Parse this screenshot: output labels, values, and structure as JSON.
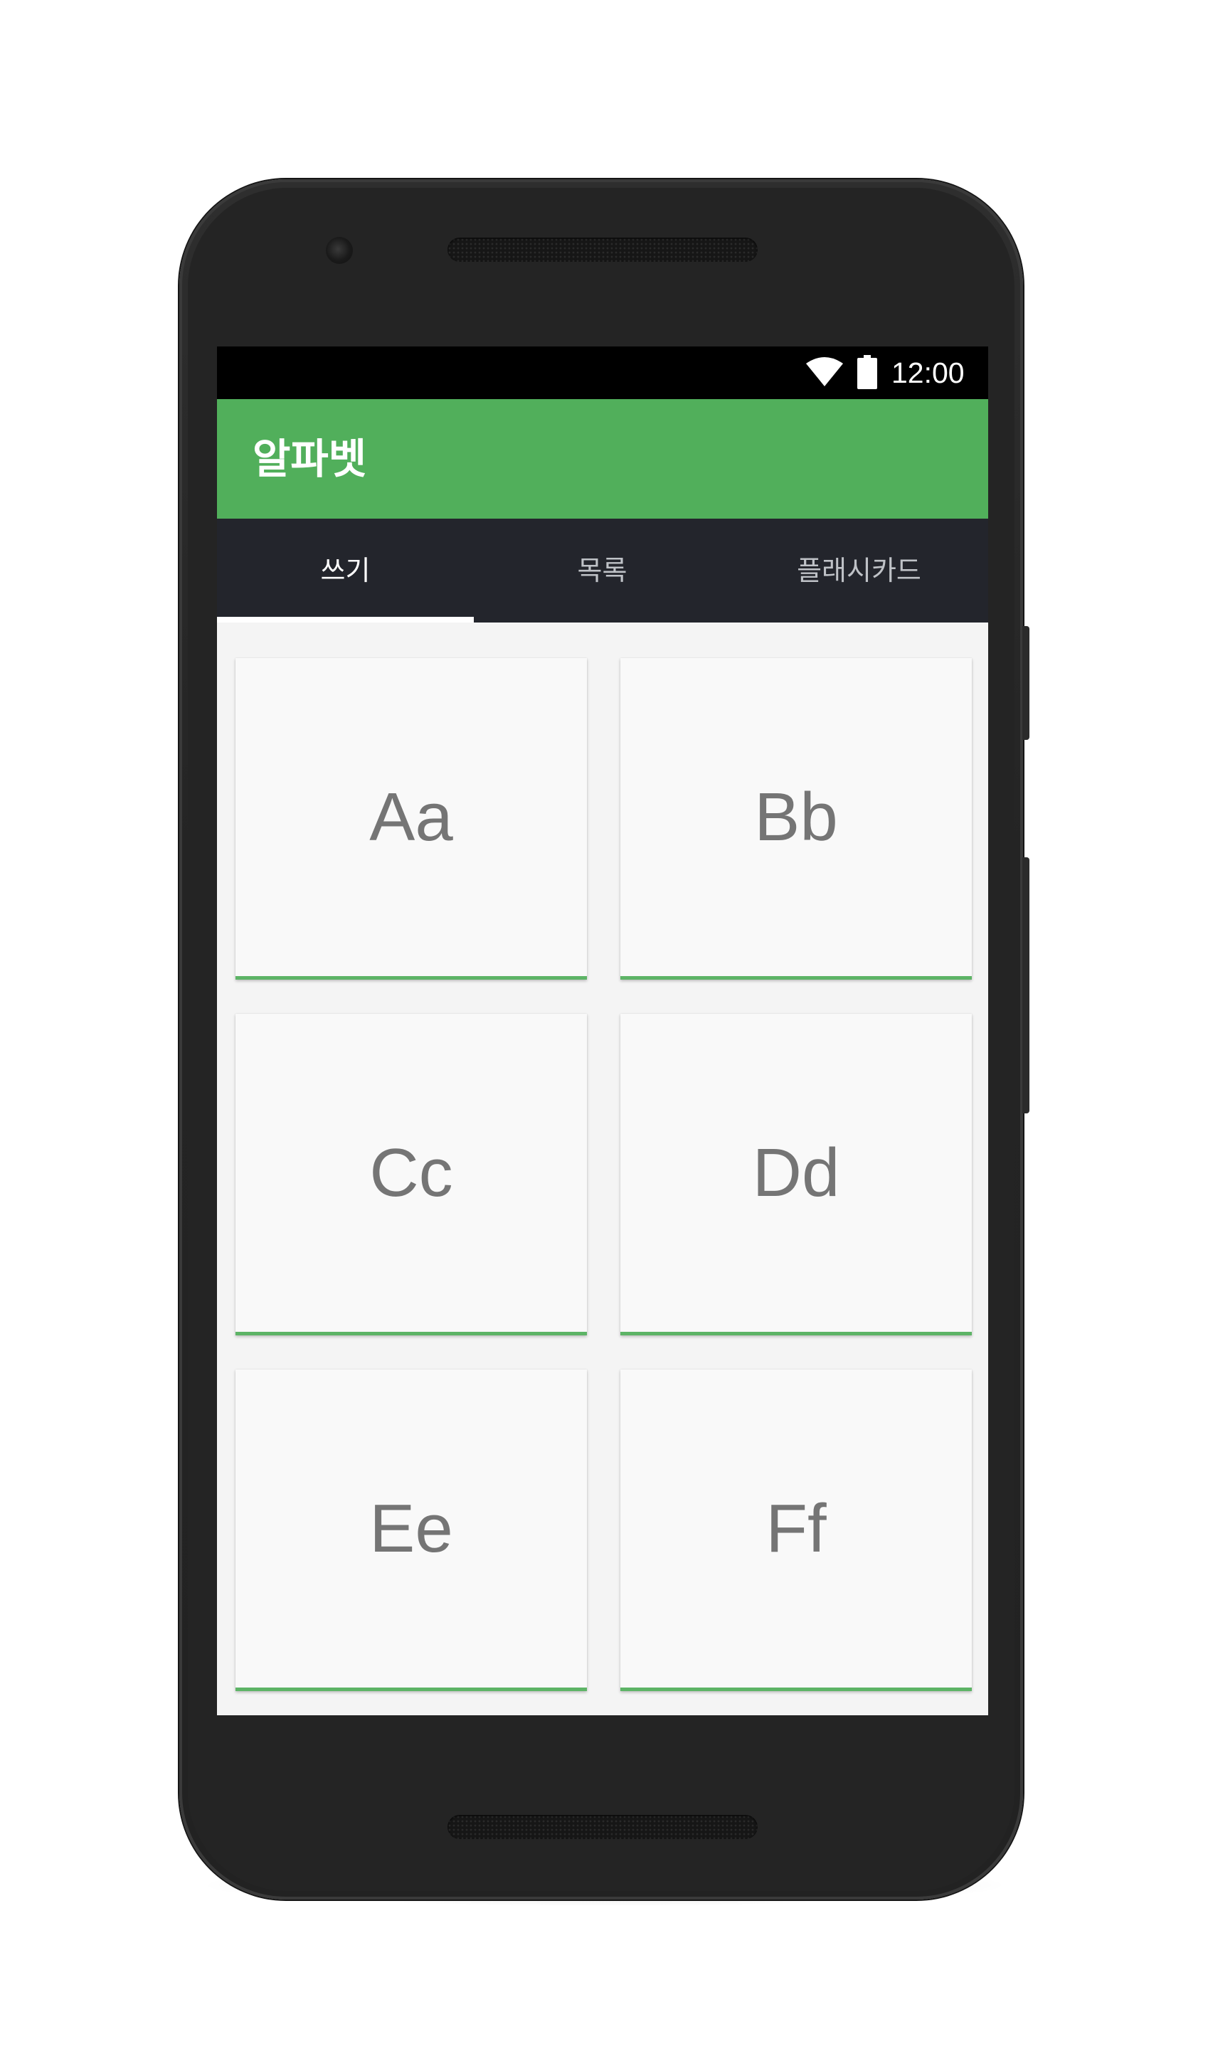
{
  "status_bar": {
    "time": "12:00",
    "wifi_icon": "wifi-icon",
    "battery_icon": "battery-icon"
  },
  "app_bar": {
    "title": "알파벳"
  },
  "tabs": [
    {
      "label": "쓰기",
      "active": true
    },
    {
      "label": "목록",
      "active": false
    },
    {
      "label": "플래시카드",
      "active": false
    }
  ],
  "cards": [
    {
      "label": "Aa"
    },
    {
      "label": "Bb"
    },
    {
      "label": "Cc"
    },
    {
      "label": "Dd"
    },
    {
      "label": "Ee"
    },
    {
      "label": "Ff"
    }
  ],
  "colors": {
    "primary": "#51af5b",
    "tab_bar": "#23252c",
    "card_accent": "#5db466",
    "card_text": "#757575"
  }
}
